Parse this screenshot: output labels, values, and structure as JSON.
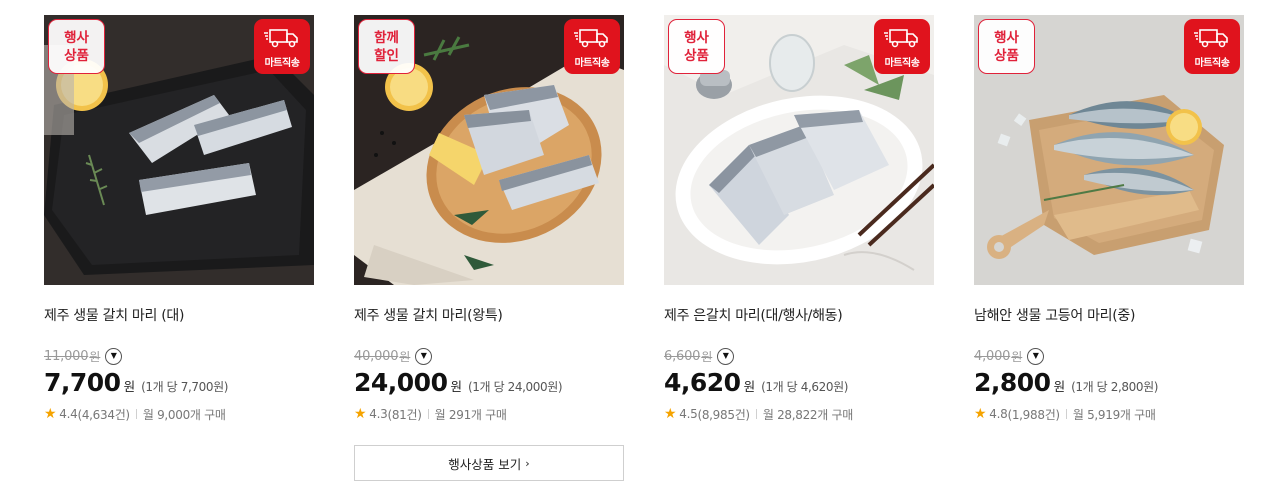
{
  "badges": {
    "delivery_label": "마트직송",
    "event_line1": "행사",
    "event_line2": "상품",
    "together_line1": "함께",
    "together_line2": "할인"
  },
  "currency_unit": "원",
  "products": [
    {
      "name": "제주 생물 갈치 마리 (대)",
      "original_price": "11,000",
      "price": "7,700",
      "unit_price": "(1개 당 7,700원)",
      "rating": "4.4",
      "review_count": "(4,634건)",
      "purchases": "월 9,000개 구매",
      "badge_line1": "행사",
      "badge_line2": "상품"
    },
    {
      "name": "제주 생물 갈치 마리(왕특)",
      "original_price": "40,000",
      "price": "24,000",
      "unit_price": "(1개 당 24,000원)",
      "rating": "4.3",
      "review_count": "(81건)",
      "purchases": "월 291개 구매",
      "badge_line1": "함께",
      "badge_line2": "할인"
    },
    {
      "name": "제주 은갈치 마리(대/행사/해동)",
      "original_price": "6,600",
      "price": "4,620",
      "unit_price": "(1개 당 4,620원)",
      "rating": "4.5",
      "review_count": "(8,985건)",
      "purchases": "월 28,822개 구매",
      "badge_line1": "행사",
      "badge_line2": "상품"
    },
    {
      "name": "남해안 생물 고등어 마리(중)",
      "original_price": "4,000",
      "price": "2,800",
      "unit_price": "(1개 당 2,800원)",
      "rating": "4.8",
      "review_count": "(1,988건)",
      "purchases": "월 5,919개 구매",
      "badge_line1": "행사",
      "badge_line2": "상품"
    }
  ],
  "more_button": {
    "label": "행사상품 보기",
    "chevron": "›"
  },
  "icons": {
    "star": "★",
    "dropdown": "▼"
  },
  "colors": {
    "accent_red": "#e0131d",
    "star": "#f5a300",
    "strike_gray": "#999999"
  }
}
